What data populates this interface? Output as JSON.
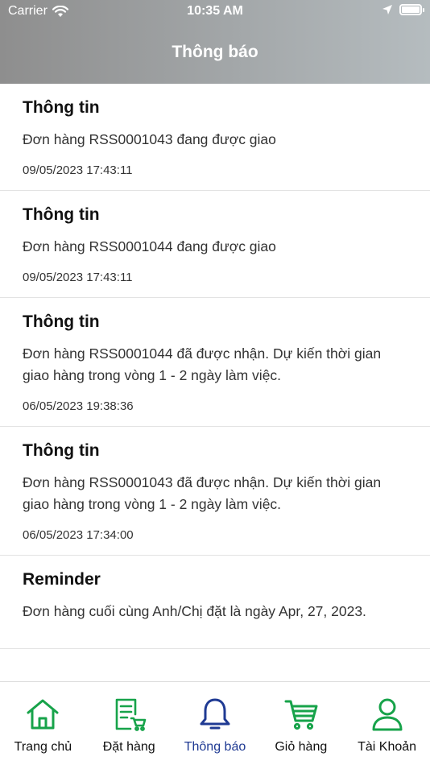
{
  "status_bar": {
    "carrier": "Carrier",
    "time": "10:35 AM"
  },
  "header": {
    "title": "Thông báo"
  },
  "notifications": [
    {
      "title": "Thông tin",
      "message": "Đơn hàng RSS0001043 đang được giao",
      "time": "09/05/2023 17:43:11"
    },
    {
      "title": "Thông tin",
      "message": "Đơn hàng RSS0001044 đang được giao",
      "time": "09/05/2023 17:43:11"
    },
    {
      "title": "Thông tin",
      "message": "Đơn hàng RSS0001044 đã được nhận. Dự kiến thời gian giao hàng trong vòng 1 - 2 ngày làm việc.",
      "time": "06/05/2023 19:38:36"
    },
    {
      "title": "Thông tin",
      "message": "Đơn hàng RSS0001043 đã được nhận. Dự kiến thời gian giao hàng trong vòng 1 - 2 ngày làm việc.",
      "time": "06/05/2023 17:34:00"
    },
    {
      "title": "Reminder",
      "message": "Đơn hàng cuối cùng Anh/Chị đặt là ngày Apr, 27, 2023.",
      "time": ""
    }
  ],
  "tabbar": {
    "tabs": [
      {
        "label": "Trang chủ",
        "icon": "home-icon"
      },
      {
        "label": "Đặt hàng",
        "icon": "order-icon"
      },
      {
        "label": "Thông báo",
        "icon": "bell-icon",
        "active": true
      },
      {
        "label": "Giỏ hàng",
        "icon": "cart-icon"
      },
      {
        "label": "Tài Khoản",
        "icon": "user-icon"
      }
    ]
  },
  "colors": {
    "accent_green": "#17a34a",
    "active_blue": "#1f3a93"
  }
}
